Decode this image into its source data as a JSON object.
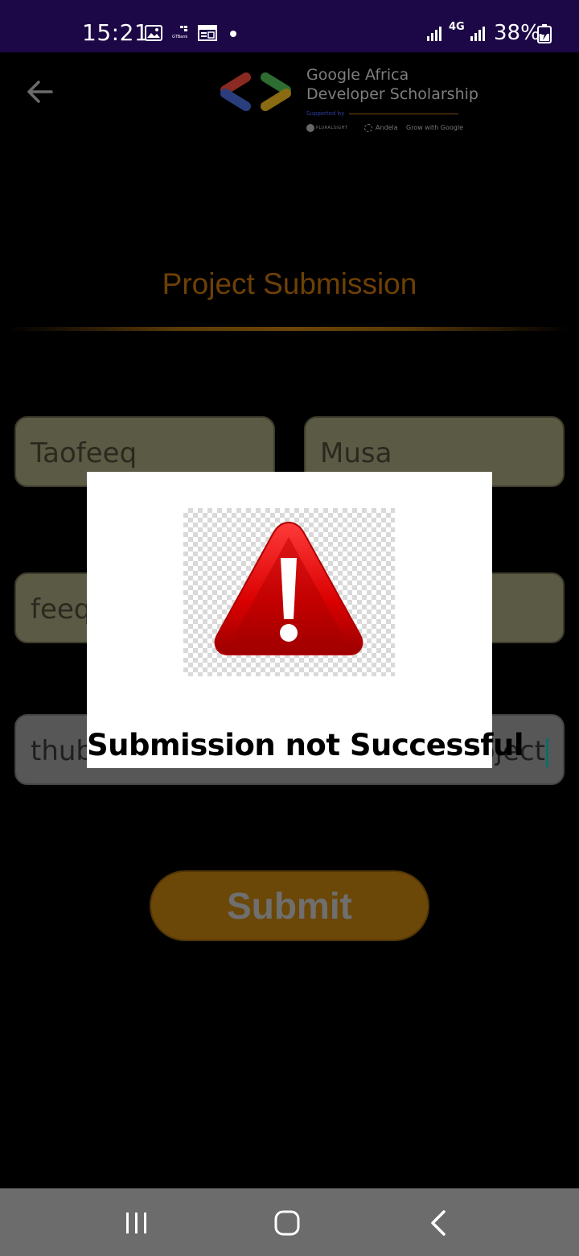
{
  "status_bar": {
    "time": "15:21",
    "gtbank_label": "GTBank",
    "network": "4G",
    "battery": "38%"
  },
  "app_bar": {
    "logo": {
      "line1": "Google Africa",
      "line2": "Developer Scholarship",
      "supported_by": "Supported by",
      "partners": [
        "PLURALSIGHT",
        "Andela",
        "Grow with Google"
      ]
    }
  },
  "page": {
    "title": "Project Submission",
    "title_color": "#6e4006"
  },
  "form": {
    "first_name": "Taofeeq",
    "last_name": "Musa",
    "email_visible": "feeq",
    "link_visible_start": "thub",
    "link_visible_end": "oject",
    "submit_label": "Submit"
  },
  "dialog": {
    "message": "Submission not Successful",
    "icon": "warning-triangle-icon"
  },
  "nav_bar": {
    "icons": [
      "recents-icon",
      "home-icon",
      "back-icon"
    ]
  }
}
